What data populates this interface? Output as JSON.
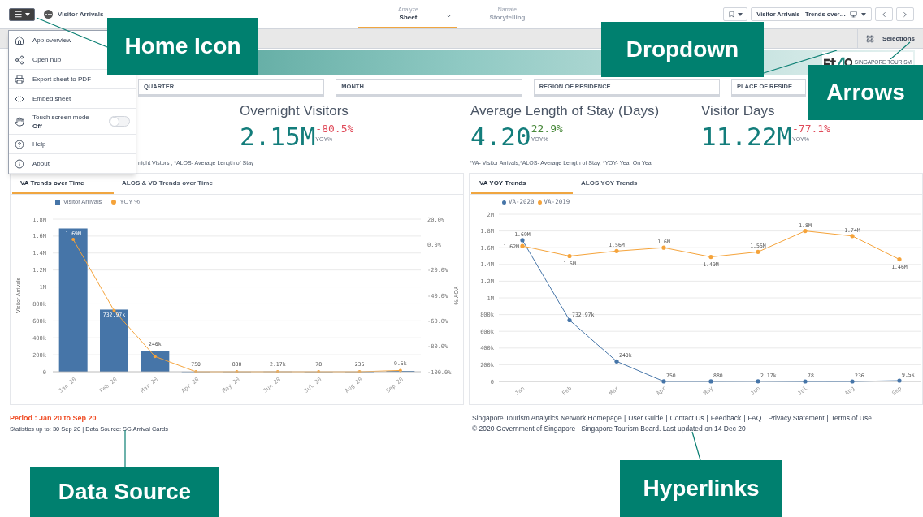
{
  "app_title": "Visitor Arrivals",
  "mode_tabs": [
    {
      "kicker": "Analyze",
      "label": "Sheet",
      "selected": true
    },
    {
      "kicker": "Narrate",
      "label": "Storytelling",
      "selected": false
    }
  ],
  "sheet_dropdown": {
    "value": "Visitor Arrivals - Trends over…"
  },
  "toolbar": {
    "selections_label": "Selections"
  },
  "logo": {
    "caption": "SINGAPORE TOURISM"
  },
  "menu": [
    {
      "kind": "item",
      "label": "App overview"
    },
    {
      "kind": "item",
      "label": "Open hub"
    },
    {
      "kind": "item",
      "label": "Export sheet to PDF"
    },
    {
      "kind": "item",
      "label": "Embed sheet"
    },
    {
      "kind": "toggle",
      "label": "Touch screen mode",
      "value": "Off",
      "on": false
    },
    {
      "kind": "item",
      "label": "Help"
    },
    {
      "kind": "item",
      "label": "About"
    }
  ],
  "filters": [
    "QUARTER",
    "MONTH",
    "REGION OF RESIDENCE",
    "PLACE OF RESIDE"
  ],
  "kpis": [
    {
      "title": "Overnight Visitors",
      "value": "2.15M",
      "change": "-80.5%",
      "color": "#e04b5a",
      "sub": "YOY%"
    },
    {
      "title": "Average Length of Stay (Days)",
      "value": "4.20",
      "change": "22.9%",
      "color": "#4a8a3c",
      "sub": "YOY%"
    },
    {
      "title": "Visitor Days",
      "value": "11.22M",
      "change": "-77.1%",
      "color": "#e04b5a",
      "sub": "YOY%"
    }
  ],
  "footnotes": [
    "night Vistors , *ALOS- Average Length of Stay",
    "*VA- Visitor Arrivals,*ALOS- Average Length of Stay, *YOY- Year On Year"
  ],
  "panels": [
    {
      "tabs": [
        {
          "label": "VA Trends over Time",
          "selected": true
        },
        {
          "label": "ALOS & VD Trends over Time",
          "selected": false
        }
      ],
      "chart_data": {
        "type": "bar",
        "categories": [
          "Jan 20",
          "Feb 20",
          "Mar 20",
          "Apr 20",
          "May 20",
          "Jun 20",
          "Jul 20",
          "Aug 20",
          "Sep 20"
        ],
        "ylabel": "Visitor Arrivals",
        "y2label": "YOY %",
        "ylim": [
          0,
          1800000
        ],
        "y2lim": [
          -100,
          20
        ],
        "grid": true,
        "legend": "top",
        "yticks": [
          {
            "value": 0,
            "label": "0"
          },
          {
            "value": 200000,
            "label": "200k"
          },
          {
            "value": 400000,
            "label": "400k"
          },
          {
            "value": 600000,
            "label": "600k"
          },
          {
            "value": 800000,
            "label": "800k"
          },
          {
            "value": 1000000,
            "label": "1M"
          },
          {
            "value": 1200000,
            "label": "1.2M"
          },
          {
            "value": 1400000,
            "label": "1.4M"
          },
          {
            "value": 1600000,
            "label": "1.6M"
          },
          {
            "value": 1800000,
            "label": "1.8M"
          }
        ],
        "y2ticks": [
          {
            "value": 20,
            "label": "20.0%"
          },
          {
            "value": 0,
            "label": "0.0%"
          },
          {
            "value": -20,
            "label": "-20.0%"
          },
          {
            "value": -40,
            "label": "-40.0%"
          },
          {
            "value": -60,
            "label": "-60.0%"
          },
          {
            "value": -80,
            "label": "-80.0%"
          },
          {
            "value": -100,
            "label": "-100.0%"
          }
        ],
        "series": [
          {
            "name": "Visitor Arrivals",
            "color": "#4675a8",
            "values": [
              1690000,
              732970,
              240000,
              750,
              880,
              2170,
              78,
              236,
              9500
            ],
            "value_labels": [
              "1.69M",
              "732.97k",
              "240k",
              "750",
              "880",
              "2.17k",
              "78",
              "236",
              "9.5k"
            ]
          },
          {
            "name": "YOY %",
            "type": "line",
            "axis": "y2",
            "color": "#f5a33a",
            "values": [
              4,
              -52,
              -88,
              -100,
              -100,
              -100,
              -100,
              -100,
              -99
            ]
          }
        ]
      }
    },
    {
      "tabs": [
        {
          "label": "VA YOY Trends",
          "selected": true
        },
        {
          "label": "ALOS YOY Trends",
          "selected": false
        }
      ],
      "chart_data": {
        "type": "line",
        "categories": [
          "Jan",
          "Feb",
          "Mar",
          "Apr",
          "May",
          "Jun",
          "Jul",
          "Aug",
          "Sep"
        ],
        "ylim": [
          0,
          2000000
        ],
        "grid": true,
        "legend": "top",
        "yticks": [
          {
            "value": 0,
            "label": "0"
          },
          {
            "value": 200000,
            "label": "200k"
          },
          {
            "value": 400000,
            "label": "400k"
          },
          {
            "value": 600000,
            "label": "600k"
          },
          {
            "value": 800000,
            "label": "800k"
          },
          {
            "value": 1000000,
            "label": "1M"
          },
          {
            "value": 1200000,
            "label": "1.2M"
          },
          {
            "value": 1400000,
            "label": "1.4M"
          },
          {
            "value": 1600000,
            "label": "1.6M"
          },
          {
            "value": 1800000,
            "label": "1.8M"
          },
          {
            "value": 2000000,
            "label": "2M"
          }
        ],
        "series": [
          {
            "name": "VA-2020",
            "color": "#4675a8",
            "values": [
              1690000,
              732970,
              240000,
              750,
              880,
              2170,
              78,
              236,
              9500
            ],
            "value_labels": [
              "1.69M",
              "732.97k",
              "240k",
              "750",
              "880",
              "2.17k",
              "78",
              "236",
              "9.5k"
            ]
          },
          {
            "name": "VA-2019",
            "color": "#f5a33a",
            "values": [
              1620000,
              1500000,
              1560000,
              1600000,
              1490000,
              1550000,
              1800000,
              1740000,
              1460000
            ],
            "value_labels": [
              "1.62M",
              "1.5M",
              "1.56M",
              "1.6M",
              "1.49M",
              "1.55M",
              "1.8M",
              "1.74M",
              "1.46M"
            ]
          }
        ]
      }
    }
  ],
  "period": "Period : Jan 20 to Sep 20",
  "statistics": "Statistics up to: 30 Sep 20 | Data Source: SG Arrival Cards",
  "footer_links": [
    "Singapore Tourism Analytics Network Homepage",
    "User Guide",
    "Contact Us",
    "Feedback",
    "FAQ",
    "Privacy Statement",
    "Terms of Use"
  ],
  "link_separator": "|",
  "copyright": "© 2020 Government of Singapore | Singapore Tourism Board. Last updated on 14 Dec 20",
  "annotations": [
    "Home Icon",
    "Dropdown",
    "Arrows",
    "Data Source",
    "Hyperlinks"
  ]
}
